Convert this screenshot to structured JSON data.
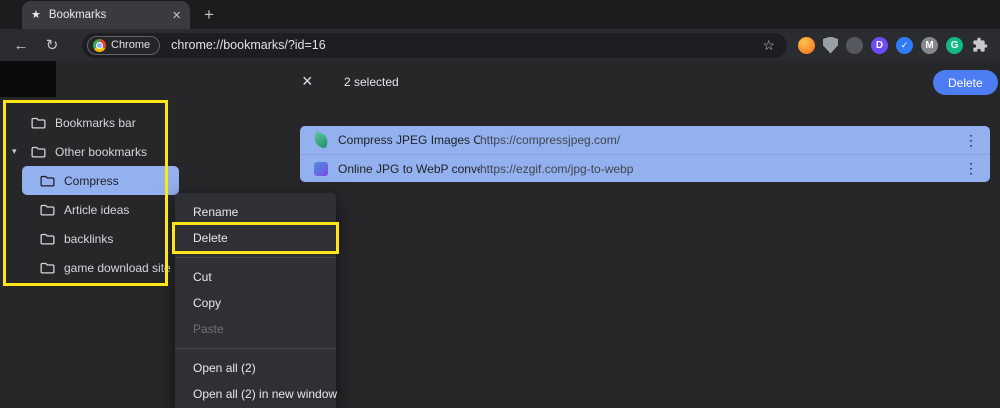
{
  "colors": {
    "selection_blue": "#93b1ef",
    "button_blue": "#4d7df2",
    "annotation_yellow": "#ffe619",
    "menu_background": "#2e3035"
  },
  "browser": {
    "tab_title": "Bookmarks",
    "url": "chrome://bookmarks/?id=16",
    "chrome_badge_label": "Chrome"
  },
  "icons": {
    "tab_favicon": "★",
    "tab_close": "×",
    "new_tab": "+",
    "back": "←",
    "reload": "↻",
    "bookmark_star": "☆",
    "clear_selection": "×",
    "overflow": "⋮",
    "expand_arrow": "▾",
    "ext_d": "D",
    "ext_check": "✓",
    "ext_m": "M",
    "ext_g": "G"
  },
  "selection_toolbar": {
    "selected_count": "2 selected",
    "delete_button": "Delete"
  },
  "sidebar": {
    "items": [
      {
        "label": "Bookmarks bar"
      },
      {
        "label": "Other bookmarks"
      },
      {
        "label": "Compress"
      },
      {
        "label": "Article ideas"
      },
      {
        "label": "backlinks"
      },
      {
        "label": "game download site"
      }
    ]
  },
  "bookmark_list": {
    "items": [
      {
        "title": "Compress JPEG Images Online",
        "url": "https://compressjpeg.com/"
      },
      {
        "title": "Online JPG to WebP converter",
        "url": "https://ezgif.com/jpg-to-webp"
      }
    ]
  },
  "context_menu": {
    "rename": "Rename",
    "delete": "Delete",
    "cut": "Cut",
    "copy": "Copy",
    "paste": "Paste",
    "open_all": "Open all (2)",
    "open_all_new_window": "Open all (2) in new window"
  }
}
